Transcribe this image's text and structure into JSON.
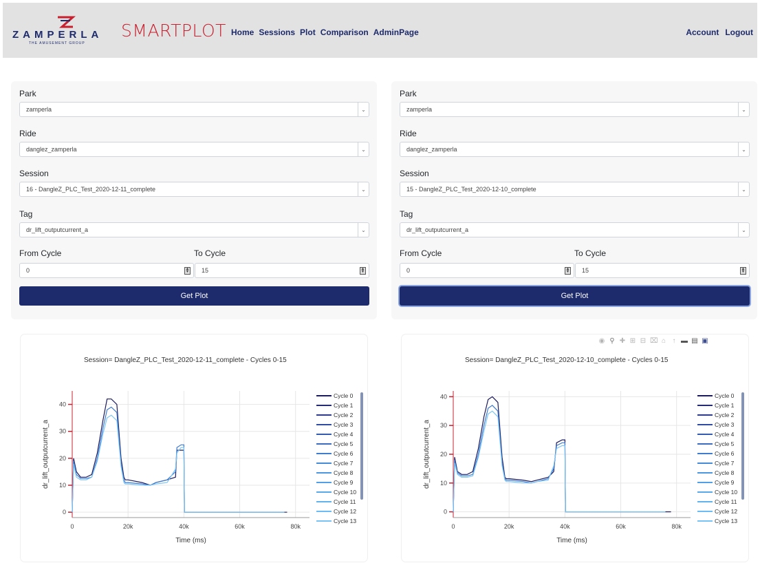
{
  "brand": {
    "zamperla": "ZAMPERLA",
    "zamperla_sub": "THE AMUSEMENT GROUP",
    "smartplot": "SMARTPLOT"
  },
  "nav": {
    "links": [
      "Home",
      "Sessions",
      "Plot",
      "Comparison",
      "AdminPage"
    ],
    "right": [
      "Account",
      "Logout"
    ]
  },
  "forms": [
    {
      "park_label": "Park",
      "park_value": "zamperla",
      "ride_label": "Ride",
      "ride_value": "danglez_zamperla",
      "session_label": "Session",
      "session_value": "16 - DangleZ_PLC_Test_2020-12-11_complete",
      "tag_label": "Tag",
      "tag_value": "dr_lift_outputcurrent_a",
      "from_label": "From Cycle",
      "from_value": "0",
      "to_label": "To Cycle",
      "to_value": "15",
      "button": "Get Plot"
    },
    {
      "park_label": "Park",
      "park_value": "zamperla",
      "ride_label": "Ride",
      "ride_value": "danglez_zamperla",
      "session_label": "Session",
      "session_value": "15 - DangleZ_PLC_Test_2020-12-10_complete",
      "tag_label": "Tag",
      "tag_value": "dr_lift_outputcurrent_a",
      "from_label": "From Cycle",
      "from_value": "0",
      "to_label": "To Cycle",
      "to_value": "15",
      "button": "Get Plot"
    }
  ],
  "colors": {
    "brand_navy": "#1d2a6b",
    "accent_red": "#c8202f",
    "navbar": "#e2e2e2"
  },
  "chart_data": [
    {
      "type": "line",
      "title": "Session= DangleZ_PLC_Test_2020-12-11_complete - Cycles 0-15",
      "xlabel": "Time (ms)",
      "ylabel": "dr_lift_outputcurrent_a",
      "x_ticks": [
        "0",
        "20k",
        "40k",
        "60k",
        "80k"
      ],
      "y_ticks": [
        "0",
        "10",
        "20",
        "30",
        "40"
      ],
      "xlim": [
        0,
        85000
      ],
      "ylim": [
        -2,
        45
      ],
      "legend": [
        "Cycle 0",
        "Cycle 1",
        "Cycle 2",
        "Cycle 3",
        "Cycle 4",
        "Cycle 5",
        "Cycle 6",
        "Cycle 7",
        "Cycle 8",
        "Cycle 9",
        "Cycle 10",
        "Cycle 11",
        "Cycle 12",
        "Cycle 13"
      ],
      "x": [
        0,
        500,
        1500,
        3000,
        5000,
        7000,
        9000,
        11000,
        12500,
        14000,
        16000,
        17500,
        18500,
        19000,
        20000,
        25000,
        28000,
        30000,
        34000,
        37000,
        37500,
        39000,
        40000,
        40200,
        50000,
        60000,
        70000,
        76000,
        77000,
        80000
      ],
      "series": [
        {
          "name": "Cycle 0",
          "values": [
            0,
            20,
            15,
            13,
            13,
            14,
            22,
            34,
            42,
            42,
            40,
            20,
            13,
            12,
            12,
            11,
            10,
            11,
            12,
            13,
            23,
            23,
            23,
            0,
            0,
            0,
            0,
            0,
            0,
            null
          ]
        },
        {
          "name": "Cycle 5",
          "values": [
            0,
            19,
            14,
            12.5,
            12.5,
            13,
            20,
            31,
            38,
            39,
            37,
            18,
            12,
            11,
            11,
            10.5,
            10,
            11,
            12,
            15,
            24,
            25,
            25,
            0,
            0,
            0,
            0,
            0,
            null,
            null
          ]
        },
        {
          "name": "Cycle 12",
          "values": [
            0,
            18,
            13,
            12,
            12,
            13,
            19,
            29,
            35,
            36,
            34,
            17,
            11,
            10.5,
            10.5,
            10,
            10,
            10.5,
            11,
            16,
            22,
            24,
            24,
            0,
            0,
            0,
            0,
            0,
            null,
            null
          ]
        }
      ]
    },
    {
      "type": "line",
      "title": "Session= DangleZ_PLC_Test_2020-12-10_complete - Cycles 0-15",
      "xlabel": "Time (ms)",
      "ylabel": "dr_lift_outputcurrent_a",
      "x_ticks": [
        "0",
        "20k",
        "40k",
        "60k",
        "80k"
      ],
      "y_ticks": [
        "0",
        "10",
        "20",
        "30",
        "40"
      ],
      "xlim": [
        0,
        85000
      ],
      "ylim": [
        -2,
        42
      ],
      "legend": [
        "Cycle 0",
        "Cycle 1",
        "Cycle 2",
        "Cycle 3",
        "Cycle 4",
        "Cycle 5",
        "Cycle 6",
        "Cycle 7",
        "Cycle 8",
        "Cycle 9",
        "Cycle 10",
        "Cycle 11",
        "Cycle 12",
        "Cycle 13"
      ],
      "x": [
        0,
        500,
        1500,
        3000,
        5000,
        7000,
        9000,
        11000,
        12500,
        14000,
        16000,
        17500,
        18500,
        19000,
        20000,
        25000,
        28000,
        30000,
        34000,
        36000,
        37000,
        39000,
        40000,
        40200,
        50000,
        60000,
        70000,
        76000,
        78000,
        80000
      ],
      "series": [
        {
          "name": "Cycle 0",
          "values": [
            0,
            19,
            14,
            13,
            13,
            14,
            22,
            33,
            39,
            40,
            38,
            19,
            12,
            11.5,
            11.5,
            11,
            10.5,
            11,
            12,
            14,
            24,
            25,
            25,
            0,
            0,
            0,
            0,
            0,
            0,
            null
          ]
        },
        {
          "name": "Cycle 5",
          "values": [
            0,
            18,
            13.5,
            12.5,
            12.5,
            13,
            20,
            30,
            36,
            37,
            35,
            17,
            11.5,
            11,
            11,
            10.5,
            10,
            10.5,
            11.5,
            15,
            23,
            24,
            24,
            0,
            0,
            0,
            0,
            0,
            null,
            null
          ]
        },
        {
          "name": "Cycle 12",
          "values": [
            0,
            17,
            13,
            12,
            12,
            12.5,
            19,
            28,
            34,
            35,
            33,
            16,
            11,
            10.5,
            10.5,
            10,
            10,
            10.5,
            11,
            16,
            22,
            23,
            23,
            0,
            0,
            0,
            0,
            0,
            null,
            null
          ]
        }
      ]
    }
  ]
}
